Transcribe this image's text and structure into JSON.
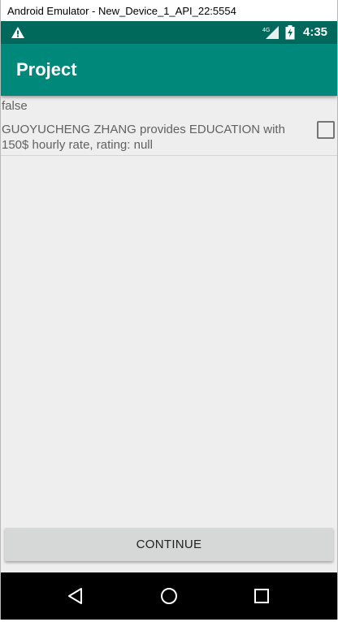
{
  "window": {
    "title": "Android Emulator - New_Device_1_API_22:5554"
  },
  "status_bar": {
    "time": "4:35",
    "network": "4G",
    "icons": [
      "warning-icon",
      "signal-4g-icon",
      "battery-charging-icon"
    ]
  },
  "app_bar": {
    "title": "Project"
  },
  "content": {
    "status_text": "false",
    "provider": {
      "text": "GUOYUCHENG ZHANG provides EDUCATION with 150$ hourly rate, rating: null",
      "checked": false
    }
  },
  "continue_button": {
    "label": "CONTINUE"
  },
  "nav_bar": {
    "icons": [
      "back-icon",
      "home-icon",
      "recents-icon"
    ]
  },
  "colors": {
    "status_bar": "#00695c",
    "app_bar": "#00897b",
    "background": "#eeeeee",
    "button": "#d6d7d7",
    "nav_bar": "#000000"
  }
}
